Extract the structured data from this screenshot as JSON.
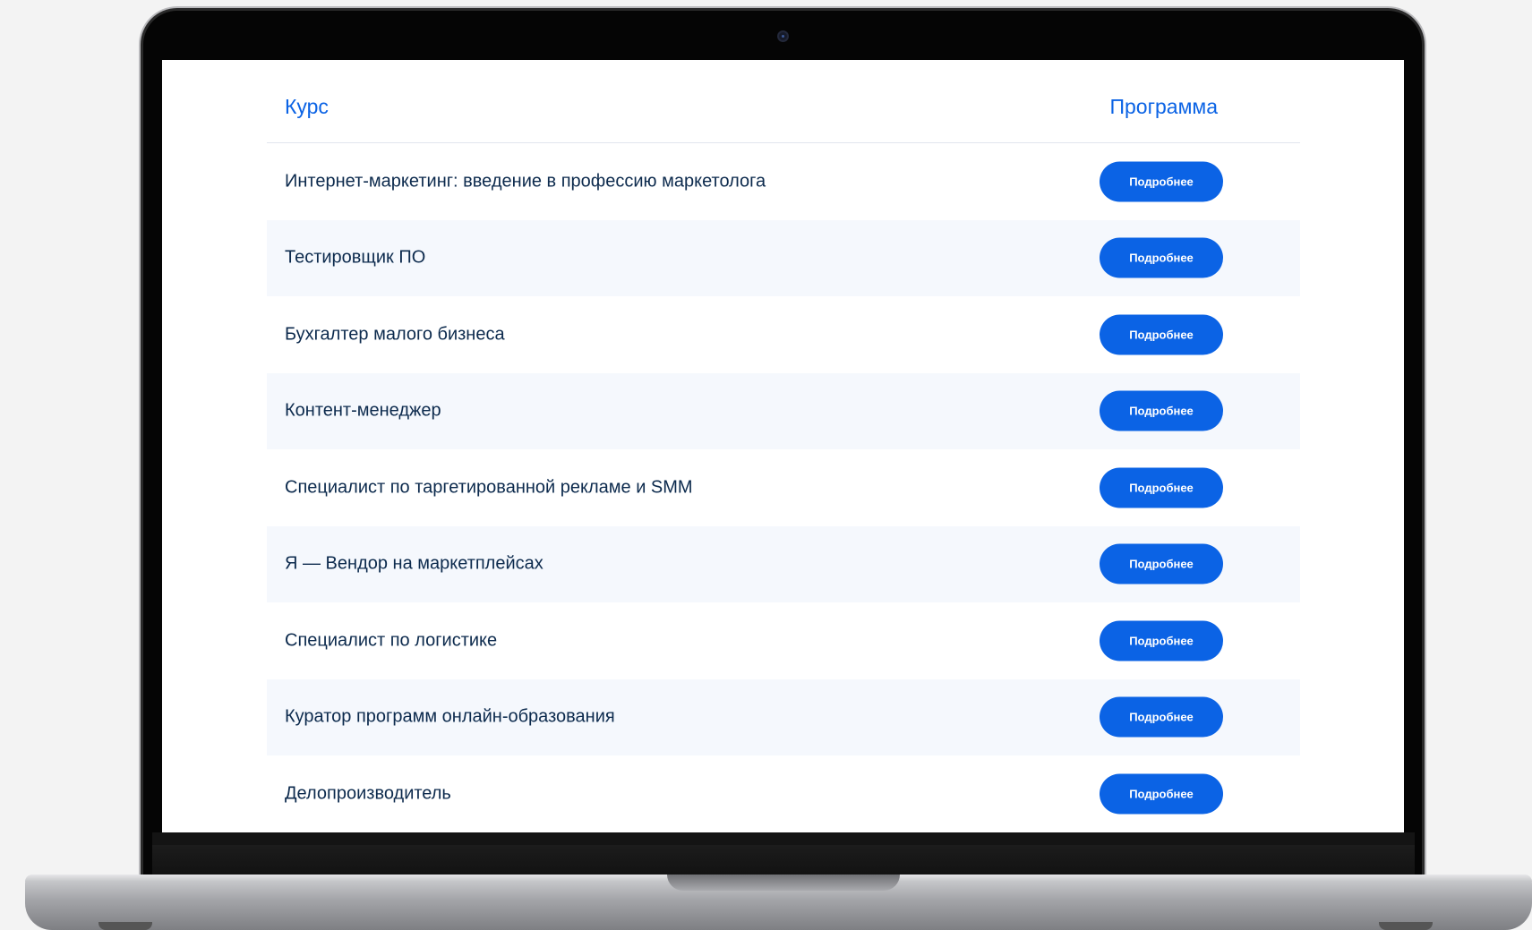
{
  "table": {
    "header_course": "Курс",
    "header_program": "Программа",
    "rows": [
      {
        "title": "Интернет-маркетинг: введение в профессию маркетолога",
        "button": "Подробнее"
      },
      {
        "title": "Тестировщик ПО",
        "button": "Подробнее"
      },
      {
        "title": "Бухгалтер малого бизнеса",
        "button": "Подробнее"
      },
      {
        "title": "Контент-менеджер",
        "button": "Подробнее"
      },
      {
        "title": "Специалист по таргетированной рекламе и SMM",
        "button": "Подробнее"
      },
      {
        "title": "Я — Вендор на маркетплейсах",
        "button": "Подробнее"
      },
      {
        "title": "Специалист по логистике",
        "button": "Подробнее"
      },
      {
        "title": "Куратор программ онлайн-образования",
        "button": "Подробнее"
      },
      {
        "title": "Делопроизводитель",
        "button": "Подробнее"
      }
    ]
  },
  "colors": {
    "accent": "#0b63e5",
    "row_text": "#0c2a4d",
    "row_alt_bg": "#f5f8fd"
  }
}
